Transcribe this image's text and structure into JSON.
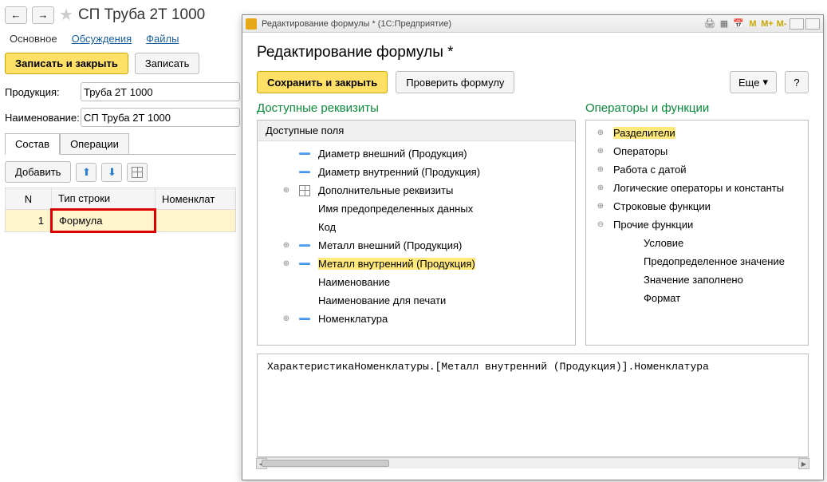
{
  "back": {
    "title": "СП Труба 2Т 1000",
    "nav": {
      "back": "←",
      "fwd": "→"
    },
    "tabs": {
      "main": "Основное",
      "disc": "Обсуждения",
      "files": "Файлы"
    },
    "buttons": {
      "save_close": "Записать и закрыть",
      "save": "Записать",
      "add": "Добавить"
    },
    "fields": {
      "product_label": "Продукция:",
      "product_value": "Труба 2Т 1000",
      "name_label": "Наименование:",
      "name_value": "СП Труба 2Т 1000"
    },
    "inner_tabs": {
      "comp": "Состав",
      "ops": "Операции"
    },
    "columns": {
      "n": "N",
      "type": "Тип строки",
      "nomen": "Номенклат"
    },
    "row": {
      "n": "1",
      "type": "Формула"
    }
  },
  "front": {
    "titlebar": "Редактирование формулы * (1С:Предприятие)",
    "heading": "Редактирование формулы *",
    "buttons": {
      "save_close": "Сохранить и закрыть",
      "check": "Проверить формулу",
      "more": "Еще",
      "help": "?"
    },
    "left_title": "Доступные реквизиты",
    "left_header": "Доступные поля",
    "left_items": [
      {
        "label": "Диаметр внешний (Продукция)",
        "exp": "",
        "dash": true
      },
      {
        "label": "Диаметр внутренний (Продукция)",
        "exp": "",
        "dash": true
      },
      {
        "label": "Дополнительные реквизиты",
        "exp": "⊕",
        "dash": false,
        "grid": true
      },
      {
        "label": "Имя предопределенных данных",
        "exp": "",
        "dash": false
      },
      {
        "label": "Код",
        "exp": "",
        "dash": false
      },
      {
        "label": "Металл внешний (Продукция)",
        "exp": "⊕",
        "dash": true
      },
      {
        "label": "Металл внутренний (Продукция)",
        "exp": "⊕",
        "dash": true,
        "hl": true
      },
      {
        "label": "Наименование",
        "exp": "",
        "dash": false
      },
      {
        "label": "Наименование для печати",
        "exp": "",
        "dash": false
      },
      {
        "label": "Номенклатура",
        "exp": "⊕",
        "dash": true
      }
    ],
    "right_title": "Операторы и функции",
    "right_items": [
      {
        "label": "Разделители",
        "exp": "⊕",
        "hl": true
      },
      {
        "label": "Операторы",
        "exp": "⊕"
      },
      {
        "label": "Работа с датой",
        "exp": "⊕"
      },
      {
        "label": "Логические операторы и константы",
        "exp": "⊕"
      },
      {
        "label": "Строковые функции",
        "exp": "⊕"
      },
      {
        "label": "Прочие функции",
        "exp": "⊖"
      },
      {
        "label": "Условие",
        "indent": true
      },
      {
        "label": "Предопределенное значение",
        "indent": true
      },
      {
        "label": "Значение заполнено",
        "indent": true
      },
      {
        "label": "Формат",
        "indent": true
      }
    ],
    "formula": "ХарактеристикаНоменклатуры.[Металл внутренний (Продукция)].Номенклатура",
    "mem": {
      "m": "M",
      "mp": "M+",
      "mm": "M-"
    }
  }
}
